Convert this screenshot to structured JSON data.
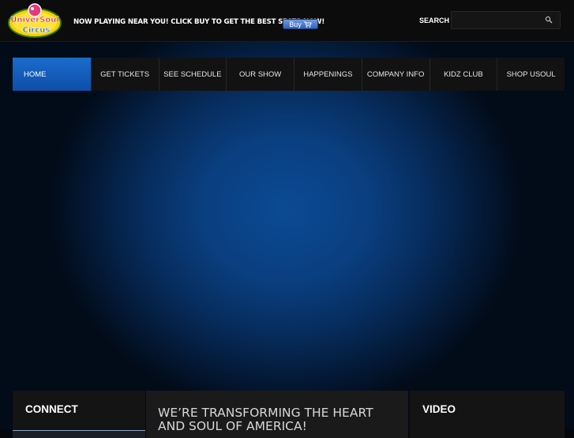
{
  "header": {
    "logo_alt": "UniverSoul Circus",
    "promo_text": "NOW PLAYING NEAR YOU! CLICK BUY TO GET THE BEST SEATS NOW!",
    "buy_label": "Buy",
    "search_label": "SEARCH",
    "search_value": "",
    "search_placeholder": ""
  },
  "nav": {
    "items": [
      {
        "label": "HOME",
        "active": true
      },
      {
        "label": "GET TICKETS"
      },
      {
        "label": "SEE SCHEDULE"
      },
      {
        "label": "OUR SHOW"
      },
      {
        "label": "HAPPENINGS"
      },
      {
        "label": "COMPANY INFO"
      },
      {
        "label": "KIDZ CLUB"
      },
      {
        "label": "SHOP USOUL"
      }
    ]
  },
  "panels": {
    "connect_title": "CONNECT",
    "main_heading": "WE’RE TRANSFORMING THE HEART AND SOUL OF AMERICA!",
    "video_title": "VIDEO"
  },
  "colors": {
    "accent": "#1b6ccd",
    "background": "#05070c",
    "hero": "#0b4a93"
  },
  "icons": [
    "universoul-circus-logo",
    "cart-icon",
    "search-icon"
  ]
}
